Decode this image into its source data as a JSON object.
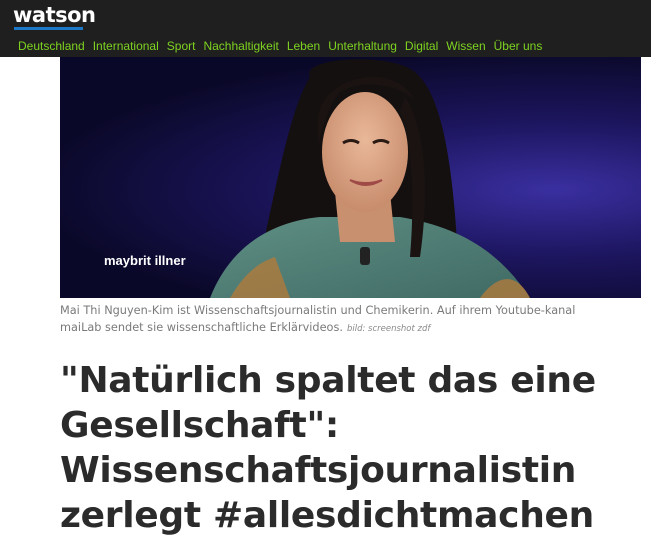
{
  "header": {
    "logo": "watson",
    "nav": [
      "Deutschland",
      "International",
      "Sport",
      "Nachhaltigkeit",
      "Leben",
      "Unterhaltung",
      "Digital",
      "Wissen",
      "Über uns"
    ]
  },
  "hero": {
    "watermark": "maybrit illner"
  },
  "caption": {
    "text": "Mai Thi Nguyen-Kim ist Wissenschaftsjournalistin und Chemikerin. Auf ihrem Youtube-kanal maiLab sendet sie wissenschaftliche Erklärvideos.",
    "credit": "bild: screenshot zdf"
  },
  "article": {
    "headline": "\"Natürlich spaltet das eine Gesellschaft\": Wissenschaftsjournalistin zerlegt #allesdichtmachen"
  },
  "colors": {
    "topbar": "#1f1f1f",
    "nav": "#7ed321",
    "logo_accent": "#1e78c8",
    "headline": "#2b2b2b"
  }
}
